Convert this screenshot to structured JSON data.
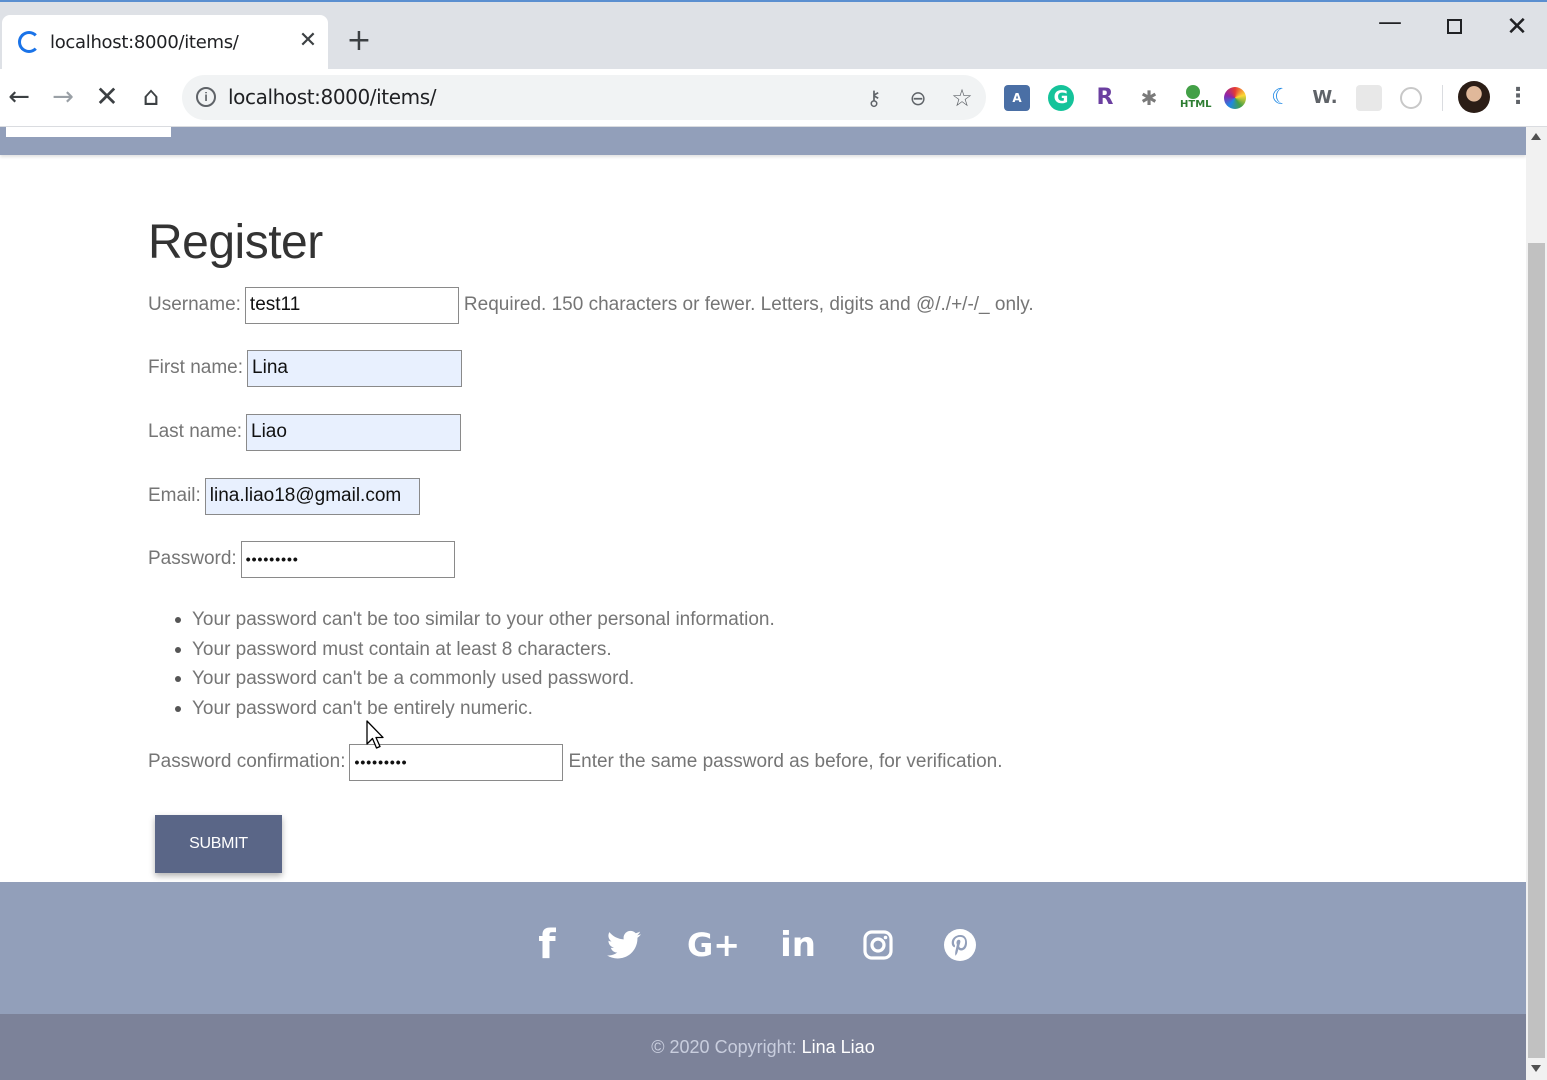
{
  "browser": {
    "tab_title": "localhost:8000/items/",
    "tab_close": "✕",
    "new_tab": "+",
    "url": "localhost:8000/items/",
    "controls": {
      "minimize": "—",
      "close": "✕"
    }
  },
  "page": {
    "title": "Register",
    "form": {
      "username": {
        "label": "Username:",
        "value": "test11",
        "help": "Required. 150 characters or fewer. Letters, digits and @/./+/-/_ only."
      },
      "first_name": {
        "label": "First name:",
        "value": "Lina"
      },
      "last_name": {
        "label": "Last name:",
        "value": "Liao"
      },
      "email": {
        "label": "Email:",
        "value": "lina.liao18@gmail.com"
      },
      "password": {
        "label": "Password:",
        "value": "•••••••••"
      },
      "password_hints": [
        "Your password can't be too similar to your other personal information.",
        "Your password must contain at least 8 characters.",
        "Your password can't be a commonly used password.",
        "Your password can't be entirely numeric."
      ],
      "password_confirmation": {
        "label": "Password confirmation:",
        "value": "•••••••••",
        "help": "Enter the same password as before, for verification."
      },
      "submit_label": "SUBMIT"
    },
    "social_icons": [
      "facebook-icon",
      "twitter-icon",
      "google-plus-icon",
      "linkedin-icon",
      "instagram-icon",
      "pinterest-icon"
    ],
    "footer": {
      "copyright": "© 2020 Copyright:",
      "owner": "Lina Liao"
    }
  },
  "colors": {
    "nav_bar": "#929fba",
    "footer_bottom": "#7c8299",
    "submit_button": "#5a6687",
    "autofill_field": "#e8f0fe"
  }
}
